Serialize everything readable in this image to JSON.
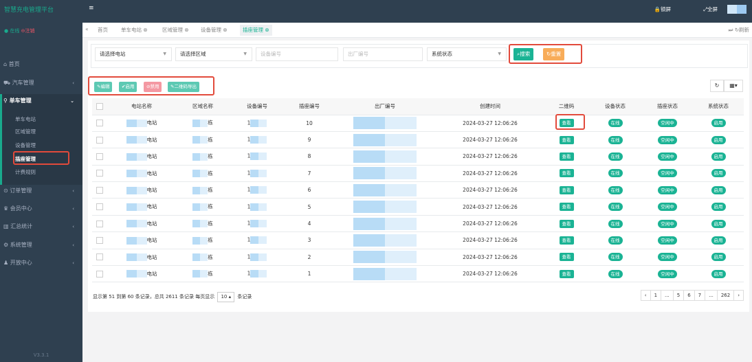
{
  "app": {
    "title": "智慧充电管理平台",
    "status_online": "在线",
    "logout": "注销",
    "version": "V3.3.1"
  },
  "sidebar": {
    "items": [
      {
        "label": "首页",
        "icon": "home-icon"
      },
      {
        "label": "汽车管理",
        "icon": "car-icon"
      },
      {
        "label": "单车管理",
        "icon": "bike-icon"
      },
      {
        "label": "订单管理",
        "icon": "order-icon"
      },
      {
        "label": "会员中心",
        "icon": "member-icon"
      },
      {
        "label": "汇总统计",
        "icon": "chart-icon"
      },
      {
        "label": "系统管理",
        "icon": "gear-icon"
      },
      {
        "label": "开放中心",
        "icon": "user-plus-icon"
      }
    ],
    "sub_items": [
      "单车电站",
      "区域管理",
      "设备管理",
      "插座管理",
      "计费规则"
    ]
  },
  "topbar": {
    "lock": "锁屏",
    "fullscreen": "全屏"
  },
  "tabs": [
    "首页",
    "单车电站",
    "区域管理",
    "设备管理",
    "插座管理"
  ],
  "tabbar": {
    "refresh": "刷新"
  },
  "search": {
    "station": "请选择电站",
    "area": "请选择区域",
    "device_ph": "设备编号",
    "factory_ph": "出厂编号",
    "status": "系统状态",
    "search_btn": "搜索",
    "reset_btn": "重置"
  },
  "toolbar": {
    "edit": "编辑",
    "enable": "启用",
    "disable": "禁用",
    "qr_export": "二维码导出"
  },
  "table": {
    "headers": [
      "电站名称",
      "区域名称",
      "设备编号",
      "插座编号",
      "出厂编号",
      "创建时间",
      "二维码",
      "设备状态",
      "插座状态",
      "系统状态"
    ],
    "rows": [
      {
        "station": "电站",
        "area": "栋",
        "device": "1",
        "socket": "10",
        "time": "2024-03-27 12:06:26"
      },
      {
        "station": "电站",
        "area": "栋",
        "device": "1",
        "socket": "9",
        "time": "2024-03-27 12:06:26"
      },
      {
        "station": "电站",
        "area": "栋",
        "device": "1",
        "socket": "8",
        "time": "2024-03-27 12:06:26"
      },
      {
        "station": "电站",
        "area": "栋",
        "device": "1",
        "socket": "7",
        "time": "2024-03-27 12:06:26"
      },
      {
        "station": "电站",
        "area": "栋",
        "device": "1",
        "socket": "6",
        "time": "2024-03-27 12:06:26"
      },
      {
        "station": "电站",
        "area": "栋",
        "device": "1",
        "socket": "5",
        "time": "2024-03-27 12:06:26"
      },
      {
        "station": "电站",
        "area": "栋",
        "device": "1",
        "socket": "4",
        "time": "2024-03-27 12:06:26"
      },
      {
        "station": "电站",
        "area": "栋",
        "device": "1",
        "socket": "3",
        "time": "2024-03-27 12:06:26"
      },
      {
        "station": "电站",
        "area": "栋",
        "device": "1",
        "socket": "2",
        "time": "2024-03-27 12:06:26"
      },
      {
        "station": "电站",
        "area": "栋",
        "device": "1",
        "socket": "1",
        "time": "2024-03-27 12:06:26"
      }
    ],
    "qr_label": "查看",
    "device_status": "在线",
    "socket_status": "空闲中",
    "system_status": "启用"
  },
  "pagination": {
    "summary_a": "显示第 51 到第 60 条记录，总共 2611 条记录 每页显示",
    "page_size": "10",
    "summary_b": "条记录",
    "pages": [
      "‹",
      "1",
      "...",
      "5",
      "6",
      "7",
      "...",
      "262",
      "›"
    ]
  },
  "colors": {
    "sidebar": "#2f4050",
    "accent": "#1ab394",
    "warning": "#f8ac59",
    "danger": "#ed5565",
    "highlight_box": "#e24a3b"
  }
}
